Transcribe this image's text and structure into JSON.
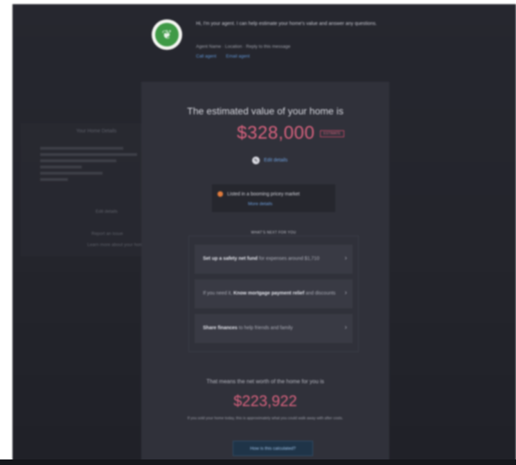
{
  "agent": {
    "message": "Hi, I'm your agent. I can help estimate your home's value and answer any questions.",
    "subline": "Agent Name · Location    ·    Reply to this message",
    "links": [
      "Call agent",
      "Email agent"
    ]
  },
  "left_panel": {
    "title": "Your Home Details",
    "link1": "Edit details",
    "link2": "Report an issue",
    "link3": "Learn more about your home"
  },
  "estimate": {
    "label": "The estimated value of your home is",
    "value": "$328,000",
    "badge": "ESTIMATE",
    "edit_label": "Edit details"
  },
  "notice": {
    "text": "Listed in a booming pricey market",
    "link": "More details"
  },
  "tips": {
    "title": "WHAT'S NEXT FOR YOU",
    "items": [
      {
        "bold": "Set up a safety net fund",
        "rest": " for expenses around $1,710"
      },
      {
        "bold": "Know mortgage payment relief",
        "rest_prefix": "If you need it, ",
        "rest": " and discounts"
      },
      {
        "bold": "Share finances",
        "rest": " to help friends and family"
      }
    ]
  },
  "net": {
    "label": "That means the net worth of the home for you is",
    "value": "$223,922",
    "note": "If you sold your home today, this is approximately what you could walk away with after costs.",
    "button": "How is this calculated?"
  },
  "colors": {
    "accent_pink": "#d9627e",
    "link_blue": "#6fa2e0",
    "avatar_green": "#3f9a46",
    "notice_orange": "#e07b3c"
  }
}
